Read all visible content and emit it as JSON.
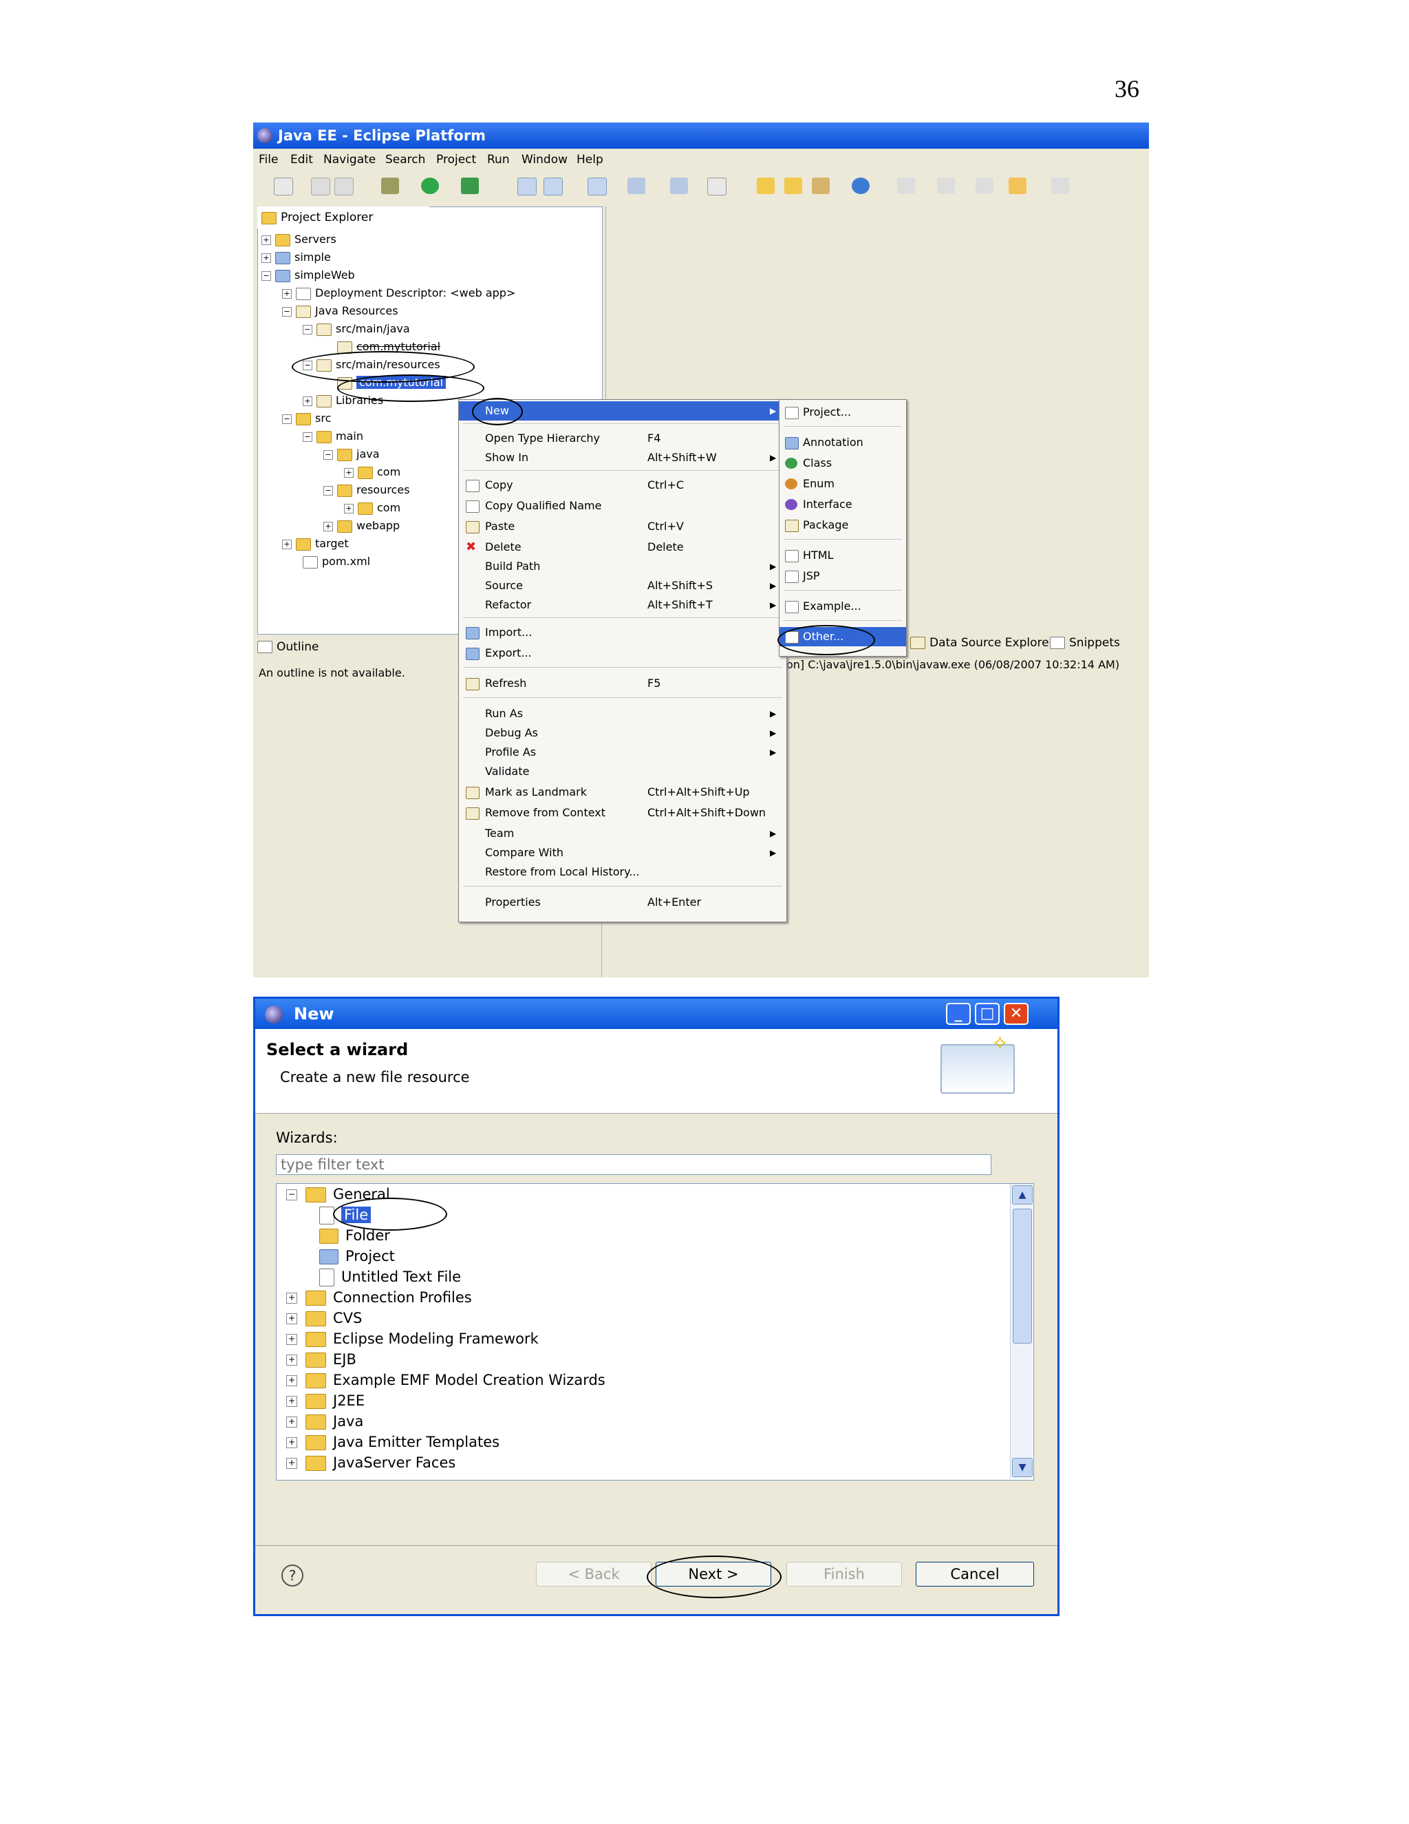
{
  "page_number": "36",
  "eclipse": {
    "title": "Java EE - Eclipse Platform",
    "menu": [
      "File",
      "Edit",
      "Navigate",
      "Search",
      "Project",
      "Run",
      "Window",
      "Help"
    ],
    "project_explorer": {
      "tab_label": "Project Explorer",
      "tree": [
        {
          "label": "Servers",
          "icon": "folder-icon"
        },
        {
          "label": "simple",
          "icon": "project-icon"
        },
        {
          "label": "simpleWeb",
          "icon": "project-icon"
        },
        {
          "label": "Deployment Descriptor: <web app>",
          "icon": "descriptor-icon"
        },
        {
          "label": "Java Resources",
          "icon": "java-resources-icon"
        },
        {
          "label": "src/main/java",
          "icon": "source-folder-icon"
        },
        {
          "label": "com.mytutorial",
          "icon": "package-icon"
        },
        {
          "label": "src/main/resources",
          "icon": "source-folder-icon"
        },
        {
          "label": "com.mytutorial",
          "icon": "package-icon"
        },
        {
          "label": "Libraries",
          "icon": "libraries-icon"
        },
        {
          "label": "src",
          "icon": "folder-icon"
        },
        {
          "label": "main",
          "icon": "folder-icon"
        },
        {
          "label": "java",
          "icon": "folder-icon"
        },
        {
          "label": "com",
          "icon": "folder-icon"
        },
        {
          "label": "resources",
          "icon": "folder-icon"
        },
        {
          "label": "com",
          "icon": "folder-icon"
        },
        {
          "label": "webapp",
          "icon": "folder-icon"
        },
        {
          "label": "target",
          "icon": "folder-icon"
        },
        {
          "label": "pom.xml",
          "icon": "xml-file-icon"
        }
      ]
    },
    "outline": {
      "tab_label": "Outline",
      "message": "An outline is not available."
    },
    "bottom_tabs": [
      "Data Source Explorer",
      "Snippets"
    ],
    "console_line": "on] C:\\java\\jre1.5.0\\bin\\javaw.exe (06/08/2007 10:32:14 AM)",
    "context_menu": [
      {
        "label": "New",
        "accel": "",
        "submenu": true
      },
      {
        "label": "Open Type Hierarchy",
        "accel": "F4",
        "submenu": false
      },
      {
        "label": "Show In",
        "accel": "Alt+Shift+W",
        "submenu": true
      },
      {
        "label": "Copy",
        "accel": "Ctrl+C",
        "submenu": false
      },
      {
        "label": "Copy Qualified Name",
        "accel": "",
        "submenu": false
      },
      {
        "label": "Paste",
        "accel": "Ctrl+V",
        "submenu": false
      },
      {
        "label": "Delete",
        "accel": "Delete",
        "submenu": false
      },
      {
        "label": "Build Path",
        "accel": "",
        "submenu": true
      },
      {
        "label": "Source",
        "accel": "Alt+Shift+S",
        "submenu": true
      },
      {
        "label": "Refactor",
        "accel": "Alt+Shift+T",
        "submenu": true
      },
      {
        "label": "Import...",
        "accel": "",
        "submenu": false
      },
      {
        "label": "Export...",
        "accel": "",
        "submenu": false
      },
      {
        "label": "Refresh",
        "accel": "F5",
        "submenu": false
      },
      {
        "label": "Run As",
        "accel": "",
        "submenu": true
      },
      {
        "label": "Debug As",
        "accel": "",
        "submenu": true
      },
      {
        "label": "Profile As",
        "accel": "",
        "submenu": true
      },
      {
        "label": "Validate",
        "accel": "",
        "submenu": false
      },
      {
        "label": "Mark as Landmark",
        "accel": "Ctrl+Alt+Shift+Up",
        "submenu": false
      },
      {
        "label": "Remove from Context",
        "accel": "Ctrl+Alt+Shift+Down",
        "submenu": false
      },
      {
        "label": "Team",
        "accel": "",
        "submenu": true
      },
      {
        "label": "Compare With",
        "accel": "",
        "submenu": true
      },
      {
        "label": "Restore from Local History...",
        "accel": "",
        "submenu": false
      },
      {
        "label": "Properties",
        "accel": "Alt+Enter",
        "submenu": false
      }
    ],
    "new_submenu": [
      "Project...",
      "Annotation",
      "Class",
      "Enum",
      "Interface",
      "Package",
      "HTML",
      "JSP",
      "Example...",
      "Other..."
    ]
  },
  "wizard": {
    "title": "New",
    "header_title": "Select a wizard",
    "header_description": "Create a new file resource",
    "wizards_label": "Wizards:",
    "filter_placeholder": "type filter text",
    "tree": [
      {
        "label": "General",
        "expanded": true
      },
      {
        "label": "File",
        "selected": true
      },
      {
        "label": "Folder"
      },
      {
        "label": "Project"
      },
      {
        "label": "Untitled Text File"
      },
      {
        "label": "Connection Profiles"
      },
      {
        "label": "CVS"
      },
      {
        "label": "Eclipse Modeling Framework"
      },
      {
        "label": "EJB"
      },
      {
        "label": "Example EMF Model Creation Wizards"
      },
      {
        "label": "J2EE"
      },
      {
        "label": "Java"
      },
      {
        "label": "Java Emitter Templates"
      },
      {
        "label": "JavaServer Faces"
      }
    ],
    "buttons": {
      "back": "< Back",
      "next": "Next >",
      "finish": "Finish",
      "cancel": "Cancel"
    },
    "help_glyph": "?"
  }
}
